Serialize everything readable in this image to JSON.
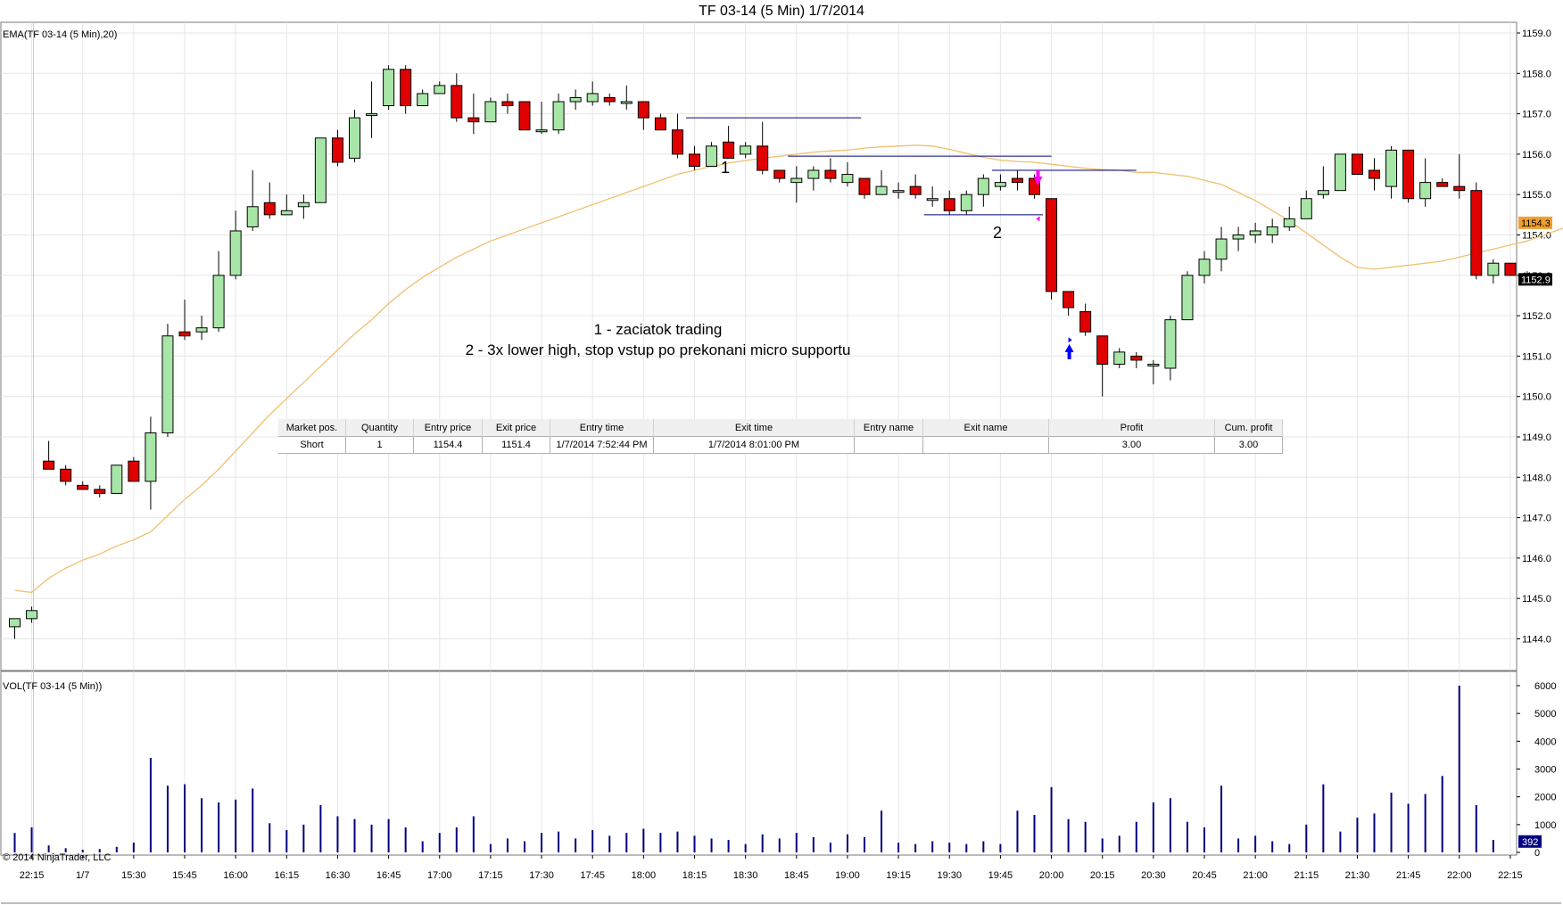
{
  "header": {
    "title": "TF 03-14 (5 Min)  1/7/2014",
    "price_panel_label": "EMA(TF 03-14 (5 Min),20)",
    "volume_panel_label": "VOL(TF 03-14 (5 Min))",
    "copyright": "© 2014 NinjaTrader, LLC"
  },
  "annotations": {
    "note_line1": "1 - zaciatok trading",
    "note_line2": "2 - 3x lower high, stop vstup po prekonani micro supportu",
    "marker_1": "1",
    "marker_2": "2"
  },
  "colors": {
    "up_candle": "#a8e6a8",
    "down_candle": "#e00000",
    "ema": "#f0c070",
    "volume": "#000080",
    "support_lines": "#000080",
    "entry_arrow": "#ff00ff",
    "exit_arrow": "#0000ff",
    "ema_tag": "#f0a030",
    "grid": "#e6e6e6"
  },
  "trade_table": {
    "headers": [
      "Market pos.",
      "Quantity",
      "Entry price",
      "Exit price",
      "Entry time",
      "Exit time",
      "Entry name",
      "Exit name",
      "Profit",
      "Cum. profit"
    ],
    "row": [
      "Short",
      "1",
      "1154.4",
      "1151.4",
      "1/7/2014 7:52:44 PM",
      "1/7/2014 8:01:00 PM",
      "",
      "",
      "3.00",
      "3.00"
    ]
  },
  "chart_data": {
    "type": "candlestick",
    "title": "TF 03-14 (5 Min)  1/7/2014",
    "price_axis": {
      "ylim": [
        1143.2,
        1159.1
      ],
      "ticks": [
        "1144.0",
        "1145.0",
        "1146.0",
        "1147.0",
        "1148.0",
        "1149.0",
        "1150.0",
        "1151.0",
        "1152.0",
        "1153.0",
        "1154.0",
        "1155.0",
        "1156.0",
        "1157.0",
        "1158.0",
        "1159.0"
      ],
      "last_price_tag": "1152.9",
      "ema_tag": "1154.3"
    },
    "volume_axis": {
      "ylim": [
        0,
        6200
      ],
      "ticks": [
        "0",
        "1000",
        "2000",
        "3000",
        "4000",
        "5000",
        "6000"
      ],
      "last_volume_tag": "392"
    },
    "x_labels": [
      {
        "bar": 1,
        "label": "22:15"
      },
      {
        "bar": 4,
        "label": "1/7"
      },
      {
        "bar": 7,
        "label": "15:30"
      },
      {
        "bar": 10,
        "label": "15:45"
      },
      {
        "bar": 13,
        "label": "16:00"
      },
      {
        "bar": 16,
        "label": "16:15"
      },
      {
        "bar": 19,
        "label": "16:30"
      },
      {
        "bar": 22,
        "label": "16:45"
      },
      {
        "bar": 25,
        "label": "17:00"
      },
      {
        "bar": 28,
        "label": "17:15"
      },
      {
        "bar": 31,
        "label": "17:30"
      },
      {
        "bar": 34,
        "label": "17:45"
      },
      {
        "bar": 37,
        "label": "18:00"
      },
      {
        "bar": 40,
        "label": "18:15"
      },
      {
        "bar": 43,
        "label": "18:30"
      },
      {
        "bar": 46,
        "label": "18:45"
      },
      {
        "bar": 49,
        "label": "19:00"
      },
      {
        "bar": 52,
        "label": "19:15"
      },
      {
        "bar": 55,
        "label": "19:30"
      },
      {
        "bar": 58,
        "label": "19:45"
      },
      {
        "bar": 61,
        "label": "20:00"
      },
      {
        "bar": 64,
        "label": "20:15"
      },
      {
        "bar": 67,
        "label": "20:30"
      },
      {
        "bar": 70,
        "label": "20:45"
      },
      {
        "bar": 73,
        "label": "21:00"
      },
      {
        "bar": 76,
        "label": "21:15"
      },
      {
        "bar": 79,
        "label": "21:30"
      },
      {
        "bar": 82,
        "label": "21:45"
      },
      {
        "bar": 85,
        "label": "22:00"
      },
      {
        "bar": 88,
        "label": "22:15"
      }
    ],
    "ohlc": [
      [
        1144.3,
        1144.5,
        1144.0,
        1144.5
      ],
      [
        1144.5,
        1144.8,
        1144.4,
        1144.7
      ],
      [
        1148.4,
        1148.9,
        1148.2,
        1148.2
      ],
      [
        1148.2,
        1148.3,
        1147.8,
        1147.9
      ],
      [
        1147.8,
        1147.9,
        1147.7,
        1147.7
      ],
      [
        1147.7,
        1147.8,
        1147.5,
        1147.6
      ],
      [
        1147.6,
        1148.3,
        1147.6,
        1148.3
      ],
      [
        1148.4,
        1148.5,
        1147.9,
        1147.9
      ],
      [
        1147.9,
        1149.5,
        1147.2,
        1149.1
      ],
      [
        1149.1,
        1151.8,
        1149.0,
        1151.5
      ],
      [
        1151.6,
        1152.4,
        1151.4,
        1151.5
      ],
      [
        1151.6,
        1152.0,
        1151.4,
        1151.7
      ],
      [
        1151.7,
        1153.6,
        1151.6,
        1153.0
      ],
      [
        1153.0,
        1154.6,
        1152.9,
        1154.1
      ],
      [
        1154.2,
        1155.6,
        1154.1,
        1154.7
      ],
      [
        1154.8,
        1155.3,
        1154.4,
        1154.5
      ],
      [
        1154.5,
        1155.0,
        1154.5,
        1154.6
      ],
      [
        1154.7,
        1155.0,
        1154.4,
        1154.8
      ],
      [
        1154.8,
        1156.4,
        1154.8,
        1156.4
      ],
      [
        1156.4,
        1156.6,
        1155.7,
        1155.8
      ],
      [
        1155.9,
        1157.1,
        1155.8,
        1156.9
      ],
      [
        1157.0,
        1157.8,
        1156.4,
        1157.0
      ],
      [
        1157.2,
        1158.2,
        1157.1,
        1158.1
      ],
      [
        1158.1,
        1158.2,
        1157.0,
        1157.2
      ],
      [
        1157.2,
        1157.6,
        1157.2,
        1157.5
      ],
      [
        1157.5,
        1157.8,
        1157.5,
        1157.7
      ],
      [
        1157.7,
        1158.0,
        1156.8,
        1156.9
      ],
      [
        1156.9,
        1157.5,
        1156.5,
        1156.8
      ],
      [
        1156.8,
        1157.4,
        1156.8,
        1157.3
      ],
      [
        1157.3,
        1157.5,
        1157.0,
        1157.2
      ],
      [
        1157.3,
        1157.3,
        1156.6,
        1156.6
      ],
      [
        1156.6,
        1157.3,
        1156.5,
        1156.6
      ],
      [
        1156.6,
        1157.5,
        1156.5,
        1157.3
      ],
      [
        1157.3,
        1157.6,
        1157.1,
        1157.4
      ],
      [
        1157.3,
        1157.8,
        1157.2,
        1157.5
      ],
      [
        1157.4,
        1157.5,
        1157.2,
        1157.3
      ],
      [
        1157.3,
        1157.7,
        1157.1,
        1157.3
      ],
      [
        1157.3,
        1157.3,
        1156.6,
        1156.9
      ],
      [
        1156.9,
        1157.0,
        1156.6,
        1156.6
      ],
      [
        1156.6,
        1157.0,
        1155.9,
        1156.0
      ],
      [
        1156.0,
        1156.2,
        1155.6,
        1155.7
      ],
      [
        1155.7,
        1156.3,
        1155.7,
        1156.2
      ],
      [
        1156.3,
        1156.7,
        1155.9,
        1155.9
      ],
      [
        1156.0,
        1156.3,
        1155.9,
        1156.2
      ],
      [
        1156.2,
        1156.8,
        1155.5,
        1155.6
      ],
      [
        1155.6,
        1155.6,
        1155.3,
        1155.4
      ],
      [
        1155.3,
        1155.7,
        1154.8,
        1155.4
      ],
      [
        1155.4,
        1155.7,
        1155.1,
        1155.6
      ],
      [
        1155.6,
        1155.9,
        1155.3,
        1155.4
      ],
      [
        1155.3,
        1155.8,
        1155.2,
        1155.5
      ],
      [
        1155.4,
        1155.4,
        1154.9,
        1155.0
      ],
      [
        1155.0,
        1155.6,
        1155.0,
        1155.2
      ],
      [
        1155.1,
        1155.3,
        1154.9,
        1155.1
      ],
      [
        1155.2,
        1155.5,
        1154.9,
        1155.0
      ],
      [
        1154.9,
        1155.2,
        1154.7,
        1154.9
      ],
      [
        1154.9,
        1155.1,
        1154.5,
        1154.6
      ],
      [
        1154.6,
        1155.1,
        1154.5,
        1155.0
      ],
      [
        1155.0,
        1155.5,
        1154.7,
        1155.4
      ],
      [
        1155.2,
        1155.5,
        1155.1,
        1155.3
      ],
      [
        1155.4,
        1155.6,
        1155.1,
        1155.3
      ],
      [
        1155.4,
        1155.5,
        1154.9,
        1155.0
      ],
      [
        1154.9,
        1154.9,
        1152.4,
        1152.6
      ],
      [
        1152.6,
        1152.6,
        1152.0,
        1152.2
      ],
      [
        1152.1,
        1152.3,
        1151.5,
        1151.6
      ],
      [
        1151.5,
        1151.5,
        1150.0,
        1150.8
      ],
      [
        1150.8,
        1151.2,
        1150.7,
        1151.1
      ],
      [
        1151.0,
        1151.1,
        1150.7,
        1150.9
      ],
      [
        1150.8,
        1150.9,
        1150.3,
        1150.8
      ],
      [
        1150.7,
        1152.0,
        1150.4,
        1151.9
      ],
      [
        1151.9,
        1153.1,
        1151.9,
        1153.0
      ],
      [
        1153.0,
        1153.6,
        1152.8,
        1153.4
      ],
      [
        1153.4,
        1154.2,
        1153.1,
        1153.9
      ],
      [
        1153.9,
        1154.2,
        1153.6,
        1154.0
      ],
      [
        1154.0,
        1154.3,
        1153.8,
        1154.1
      ],
      [
        1154.0,
        1154.4,
        1153.8,
        1154.2
      ],
      [
        1154.2,
        1154.7,
        1154.1,
        1154.4
      ],
      [
        1154.4,
        1155.1,
        1154.4,
        1154.9
      ],
      [
        1155.0,
        1155.7,
        1154.9,
        1155.1
      ],
      [
        1155.1,
        1156.0,
        1155.1,
        1156.0
      ],
      [
        1156.0,
        1156.0,
        1155.5,
        1155.5
      ],
      [
        1155.6,
        1155.9,
        1155.1,
        1155.4
      ],
      [
        1155.2,
        1156.2,
        1154.9,
        1156.1
      ],
      [
        1156.1,
        1156.1,
        1154.8,
        1154.9
      ],
      [
        1154.9,
        1155.9,
        1154.7,
        1155.3
      ],
      [
        1155.3,
        1155.4,
        1155.2,
        1155.2
      ],
      [
        1155.2,
        1156.0,
        1154.9,
        1155.1
      ],
      [
        1155.1,
        1155.3,
        1152.9,
        1153.0
      ],
      [
        1153.0,
        1153.4,
        1152.8,
        1153.3
      ],
      [
        1153.3,
        1153.3,
        1153.0,
        1153.0
      ],
      [
        1153.0,
        1153.1,
        1152.8,
        1152.8
      ]
    ],
    "ema": [
      1145.2,
      1145.15,
      1145.5,
      1145.75,
      1145.95,
      1146.1,
      1146.3,
      1146.45,
      1146.65,
      1147.05,
      1147.45,
      1147.8,
      1148.2,
      1148.65,
      1149.1,
      1149.55,
      1149.95,
      1150.35,
      1150.75,
      1151.15,
      1151.55,
      1151.9,
      1152.3,
      1152.65,
      1152.95,
      1153.2,
      1153.45,
      1153.65,
      1153.85,
      1154.0,
      1154.15,
      1154.3,
      1154.45,
      1154.6,
      1154.75,
      1154.9,
      1155.05,
      1155.2,
      1155.35,
      1155.5,
      1155.6,
      1155.7,
      1155.78,
      1155.84,
      1155.9,
      1155.95,
      1156.0,
      1156.05,
      1156.08,
      1156.1,
      1156.15,
      1156.18,
      1156.2,
      1156.22,
      1156.2,
      1156.12,
      1156.02,
      1155.92,
      1155.85,
      1155.82,
      1155.8,
      1155.75,
      1155.7,
      1155.65,
      1155.62,
      1155.6,
      1155.55,
      1155.55,
      1155.5,
      1155.45,
      1155.35,
      1155.25,
      1155.05,
      1154.85,
      1154.6,
      1154.35,
      1154.05,
      1153.75,
      1153.45,
      1153.2,
      1153.15,
      1153.2,
      1153.25,
      1153.3,
      1153.35,
      1153.45,
      1153.55,
      1153.65,
      1153.75,
      1153.85,
      1154.0,
      1154.15,
      1154.35,
      1154.45,
      1154.55,
      1154.55,
      1154.6,
      1154.55,
      1154.45,
      1154.3
    ],
    "volume": [
      700,
      900,
      250,
      150,
      100,
      120,
      200,
      350,
      3400,
      2400,
      2450,
      1950,
      1800,
      1900,
      2300,
      1050,
      800,
      1000,
      1700,
      1300,
      1200,
      1000,
      1200,
      900,
      400,
      700,
      900,
      1300,
      300,
      500,
      400,
      700,
      750,
      500,
      800,
      600,
      700,
      850,
      700,
      750,
      600,
      500,
      450,
      300,
      650,
      500,
      700,
      550,
      350,
      650,
      550,
      1500,
      350,
      300,
      400,
      350,
      300,
      400,
      300,
      1500,
      1350,
      2350,
      1200,
      1100,
      500,
      600,
      1100,
      1800,
      1950,
      1100,
      900,
      2400,
      500,
      600,
      400,
      300,
      1000,
      2450,
      750,
      1250,
      1400,
      2150,
      1750,
      2100,
      2750,
      6000,
      1700,
      450
    ],
    "levels": [
      {
        "price": 1156.9,
        "from_bar": 39.5,
        "to_bar": 49.8
      },
      {
        "price": 1155.95,
        "from_bar": 45.5,
        "to_bar": 61.0
      },
      {
        "price": 1155.6,
        "from_bar": 57.5,
        "to_bar": 66.0
      },
      {
        "price": 1154.5,
        "from_bar": 53.5,
        "to_bar": 60.5
      }
    ],
    "trade": {
      "entry_bar": 60,
      "entry_price": 1154.4,
      "exit_bar": 62,
      "exit_price": 1151.4
    }
  }
}
